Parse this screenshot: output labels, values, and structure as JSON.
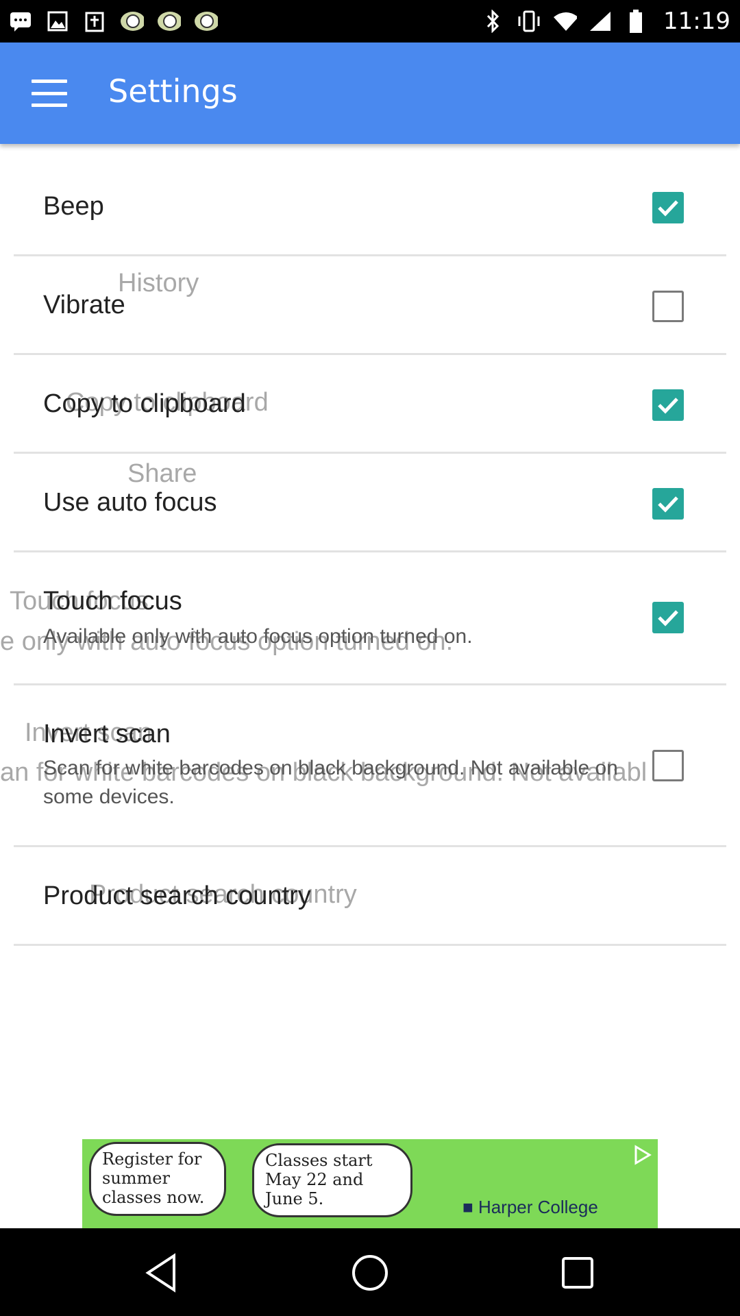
{
  "status_bar": {
    "time": "11:19",
    "left_icons": [
      "chat-icon",
      "image-icon",
      "notification-icon",
      "soccer-icon",
      "soccer-icon",
      "soccer-icon"
    ],
    "right_icons": [
      "bluetooth-icon",
      "vibrate-icon",
      "wifi-icon",
      "signal-icon",
      "battery-icon"
    ]
  },
  "appbar": {
    "title": "Settings",
    "menu_icon": "hamburger-menu-icon"
  },
  "settings": [
    {
      "title": "Beep",
      "checked": true
    },
    {
      "title": "Vibrate",
      "checked": false
    },
    {
      "title": "Copy to clipboard",
      "checked": true
    },
    {
      "title": "Use auto focus",
      "checked": true
    },
    {
      "title": "Touch focus",
      "subtitle": "Available only with auto focus option turned on.",
      "checked": true
    },
    {
      "title": "Invert scan",
      "subtitle": "Scan for white barcodes on black background. Not available on some devices.",
      "checked": false
    },
    {
      "title": "Product search country"
    }
  ],
  "ghost_texts": {
    "history": "History",
    "copy": "Copy to clipboard",
    "share": "Share",
    "touch": "Touch focus",
    "touch_sub": "e only with auto focus option turned on.",
    "invert": "Invert scan",
    "invert_sub": "an for white barcodes on black background. Not availabl",
    "product": "Product search country"
  },
  "ad": {
    "bubble1": "Register for summer classes now.",
    "bubble2": "Classes start May 22 and June 5.",
    "brand": "Harper College"
  },
  "colors": {
    "appbar": "#4a89ef",
    "checkbox_on": "#26a69a",
    "ad_bg": "#7ed957"
  }
}
